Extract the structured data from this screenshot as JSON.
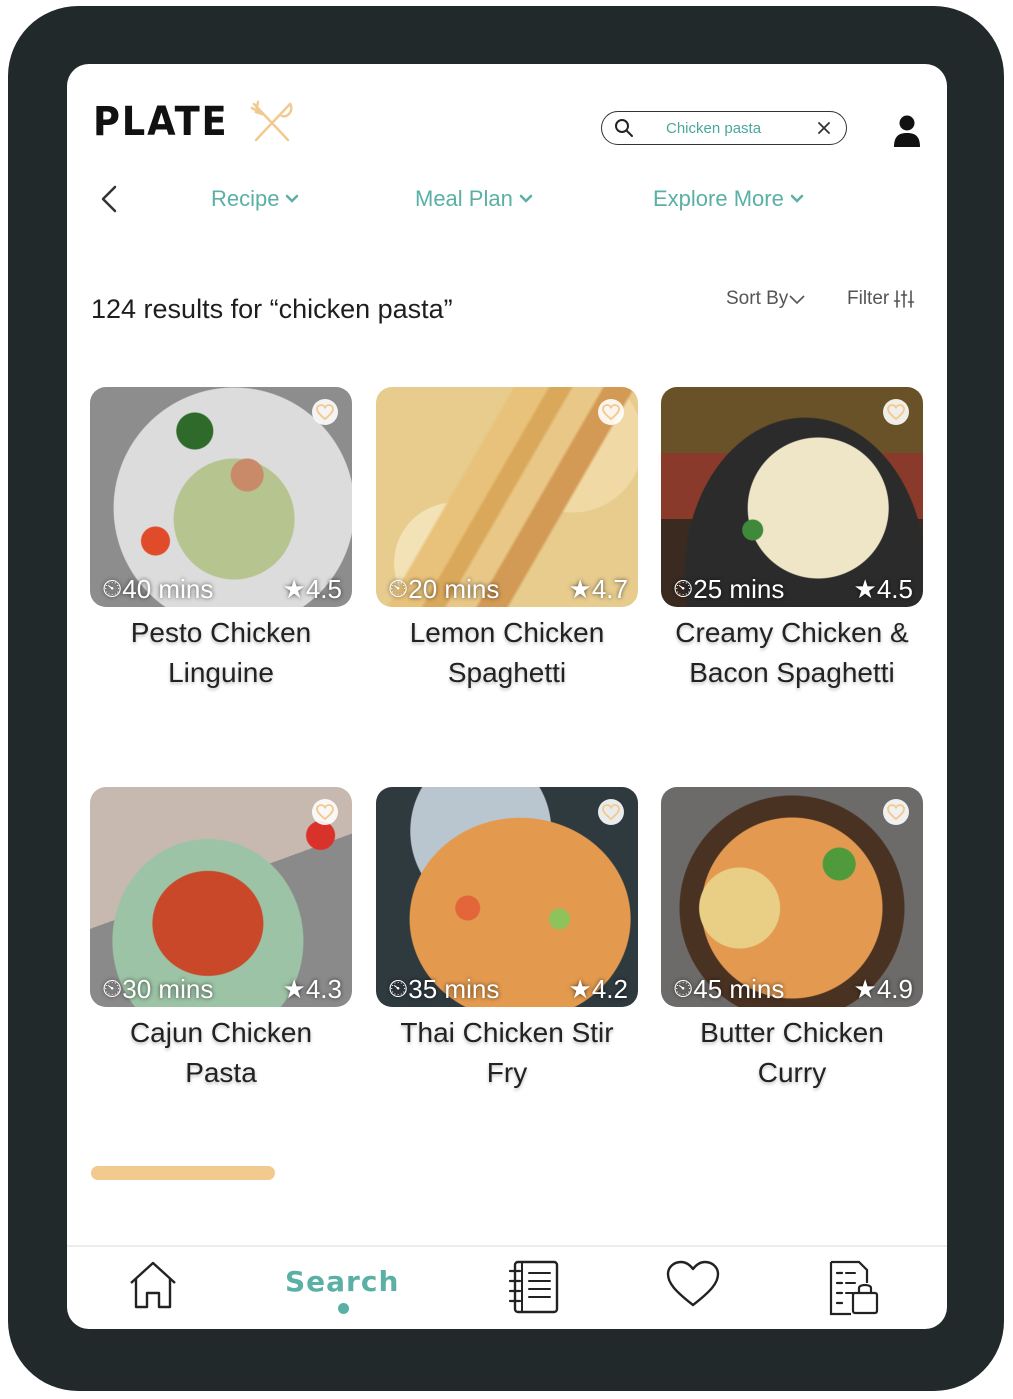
{
  "app": {
    "logo_text": "PLATE"
  },
  "search": {
    "query": "Chicken pasta"
  },
  "nav": {
    "items": [
      {
        "label": "Recipe"
      },
      {
        "label": "Meal Plan"
      },
      {
        "label": "Explore More"
      }
    ]
  },
  "results": {
    "summary": "124 results for “chicken pasta”",
    "sort_label": "Sort By",
    "filter_label": "Filter"
  },
  "recipes": [
    {
      "title_line1": "Pesto Chicken",
      "title_line2": "Linguine",
      "time": "40 mins",
      "rating": "4.5"
    },
    {
      "title_line1": "Lemon Chicken",
      "title_line2": "Spaghetti",
      "time": "20 mins",
      "rating": "4.7"
    },
    {
      "title_line1": "Creamy Chicken &",
      "title_line2": "Bacon Spaghetti",
      "time": "25 mins",
      "rating": "4.5"
    },
    {
      "title_line1": "Cajun Chicken",
      "title_line2": "Pasta",
      "time": "30 mins",
      "rating": "4.3"
    },
    {
      "title_line1": "Thai Chicken Stir",
      "title_line2": "Fry",
      "time": "35 mins",
      "rating": "4.2"
    },
    {
      "title_line1": "Butter Chicken",
      "title_line2": "Curry",
      "time": "45 mins",
      "rating": "4.9"
    }
  ],
  "tabbar": {
    "active_label": "Search"
  },
  "colors": {
    "accent": "#5ab0a4",
    "secondary": "#f2c98f",
    "frame": "#21292a"
  }
}
